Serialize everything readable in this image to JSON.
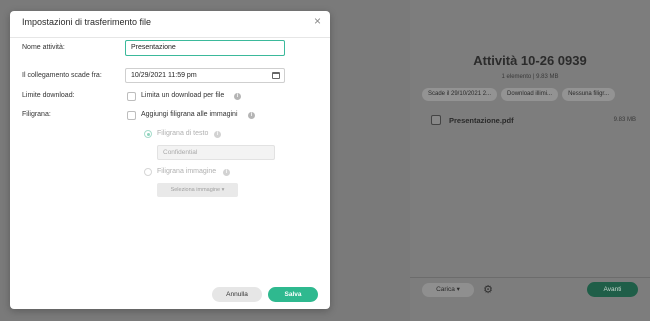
{
  "background": {
    "title": "Attività 10-26 0939",
    "subtitle": "1 elemento | 9.83 MB",
    "chips": [
      "Scade il 29/10/2021 2...",
      "Download illimi...",
      "Nessuna filigr..."
    ],
    "file": {
      "name": "Presentazione.pdf",
      "size": "9.83 MB"
    },
    "carica_label": "Carica",
    "avanti_label": "Avanti"
  },
  "modal": {
    "title": "Impostazioni di trasferimento file",
    "close_glyph": "×",
    "fields": {
      "activity_name_label": "Nome attività:",
      "activity_name_value": "Presentazione",
      "expiry_label": "Il collegamento scade fra:",
      "expiry_value": "10/29/2021 11:59 pm",
      "download_limit_label": "Limite download:",
      "download_limit_option": "Limita un download per file",
      "watermark_label": "Filigrana:",
      "watermark_option": "Aggiungi filigrana alle immagini",
      "text_watermark_option": "Filigrana di testo",
      "text_watermark_value": "Confidential",
      "image_watermark_option": "Filigrana immagine",
      "select_image_label": "Seleziona immagine ▾"
    },
    "buttons": {
      "cancel": "Annulla",
      "save": "Salva"
    }
  },
  "colors": {
    "accent": "#2fb98f",
    "overlay": "#7a7a7a"
  }
}
